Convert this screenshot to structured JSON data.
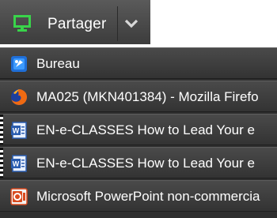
{
  "share": {
    "label": "Partager",
    "icon": "monitor-icon",
    "dropdown_icon": "chevron-down-icon"
  },
  "windows": [
    {
      "label": "Bureau",
      "icon": "desktop-icon"
    },
    {
      "label": "MA025 (MKN401384) - Mozilla Firefo",
      "icon": "firefox-icon"
    },
    {
      "label": "EN-e-CLASSES How to Lead Your e",
      "icon": "word-document-icon"
    },
    {
      "label": "EN-e-CLASSES How to Lead Your e",
      "icon": "word-document-icon"
    },
    {
      "label": "Microsoft PowerPoint non-commercia",
      "icon": "powerpoint-icon"
    }
  ],
  "colors": {
    "bar": "#4a4a4a",
    "accent_green": "#39d44a",
    "text": "#ffffff"
  }
}
